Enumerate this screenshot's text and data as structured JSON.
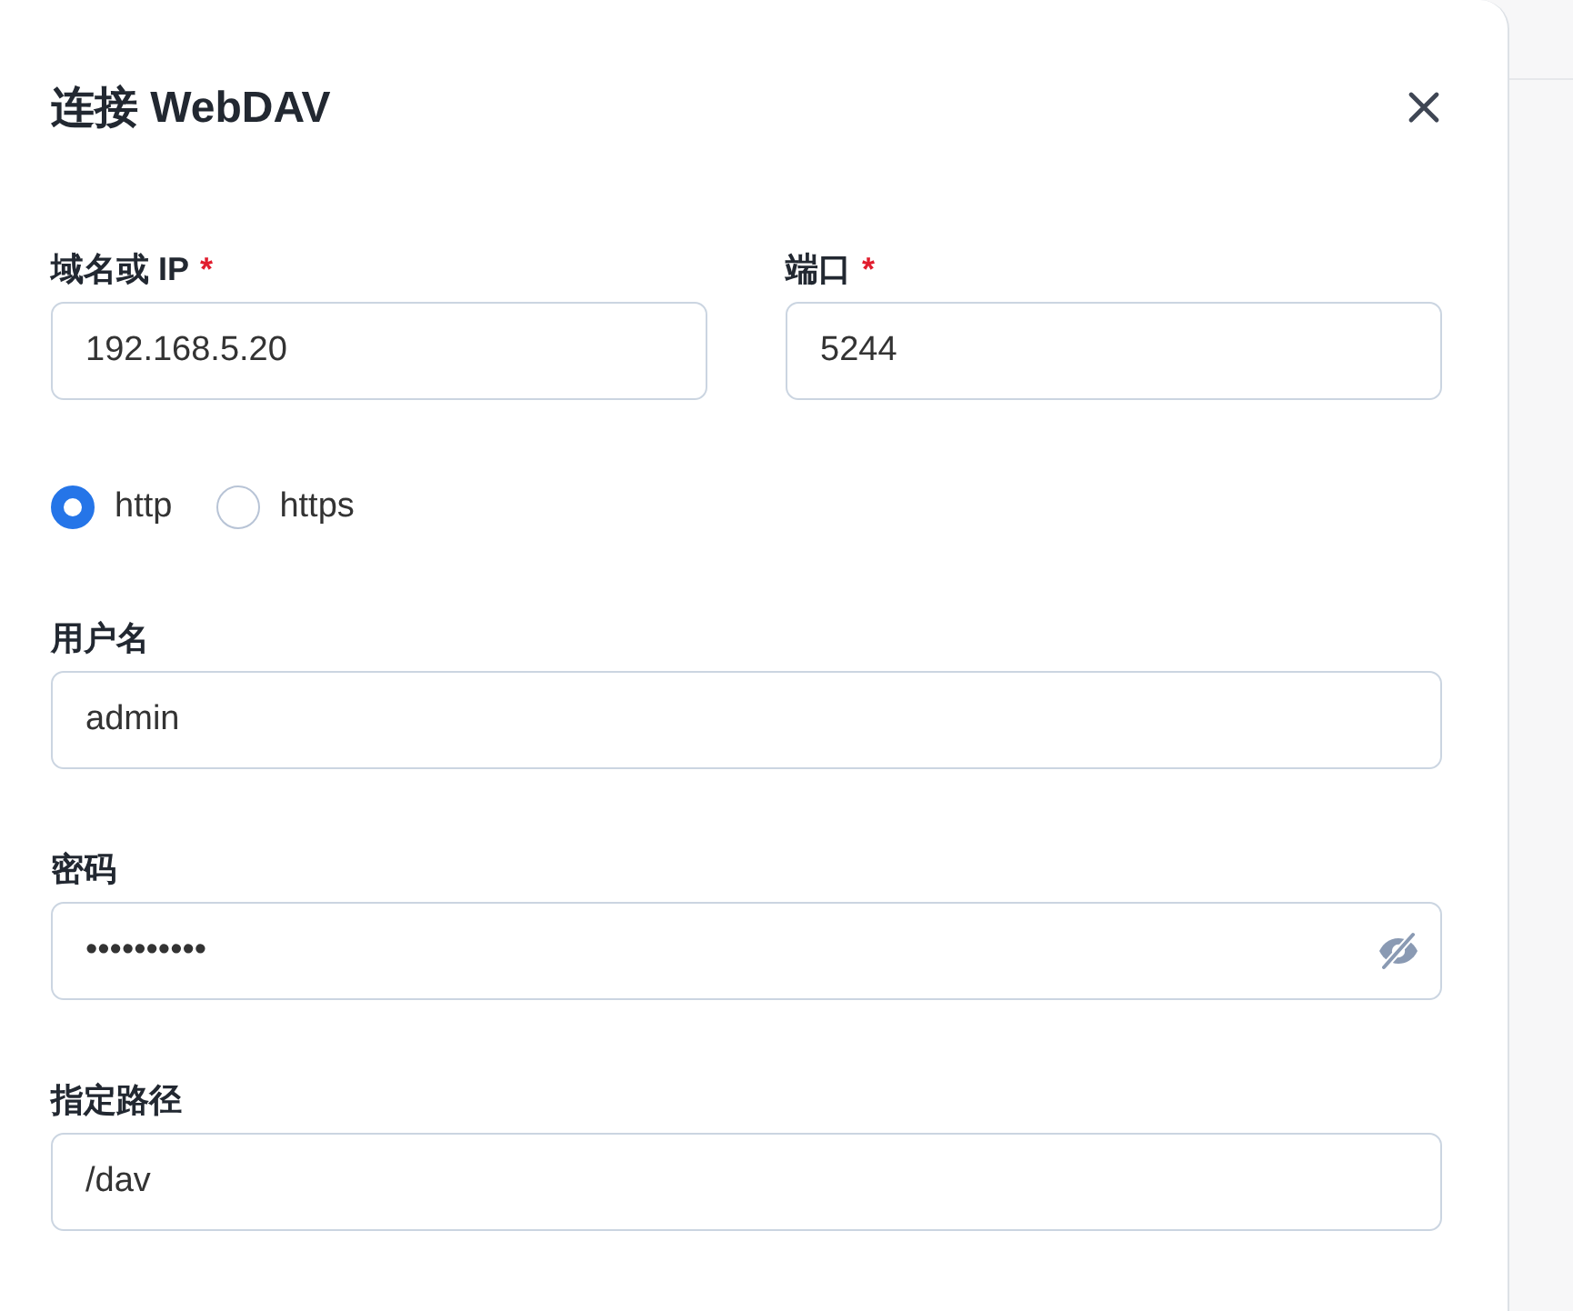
{
  "dialog": {
    "title": "连接 WebDAV"
  },
  "host_port": [
    {
      "label": "域名或 IP",
      "required_mark": "*",
      "value": "192.168.5.20"
    },
    {
      "label": "端口",
      "required_mark": "*",
      "value": "5244"
    }
  ],
  "protocol": [
    {
      "label": "http",
      "selected": true
    },
    {
      "label": "https",
      "selected": false
    }
  ],
  "fields": [
    {
      "kind": "text",
      "label": "用户名",
      "value": "admin"
    },
    {
      "kind": "password",
      "label": "密码",
      "value": "••••••••••"
    },
    {
      "kind": "text",
      "label": "指定路径",
      "value": "/dav"
    }
  ]
}
